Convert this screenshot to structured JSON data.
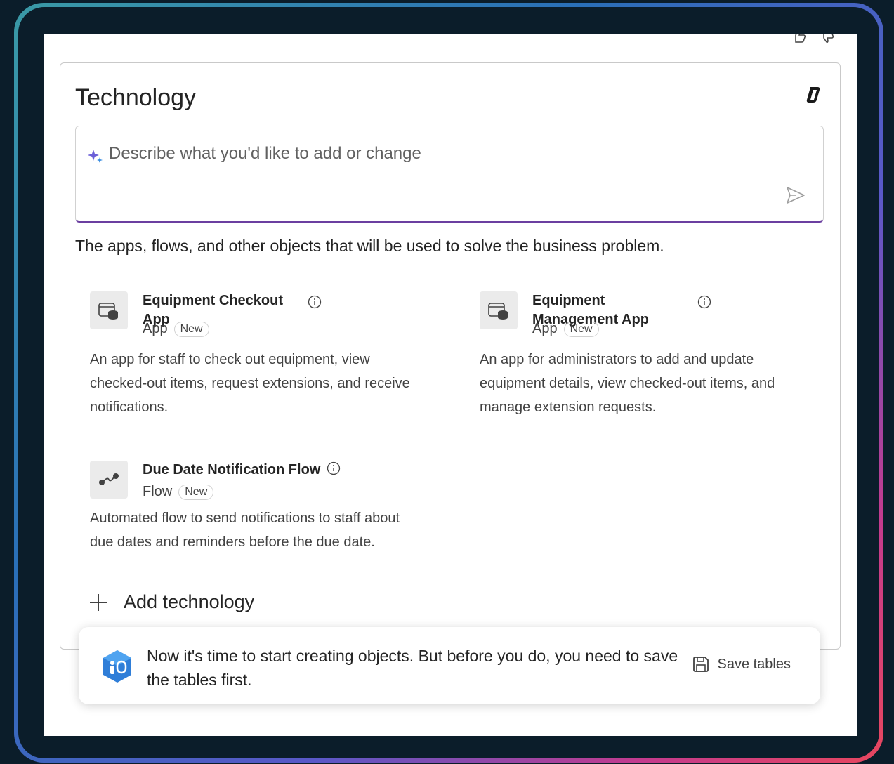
{
  "section": {
    "title": "Technology",
    "prompt_placeholder": "Describe what you'd like to add or change",
    "description": "The apps, flows, and other objects that will be used to solve the business problem."
  },
  "items": [
    {
      "title_line1": "Equipment Checkout",
      "title_line2": "App",
      "type": "App",
      "badge": "New",
      "desc_lines": [
        "An app for staff to check out equipment, view",
        "checked-out items, request extensions, and receive",
        "notifications."
      ],
      "icon": "app-icon"
    },
    {
      "title_line1": "Equipment",
      "title_line2": "Management App",
      "type": "App",
      "badge": "New",
      "desc_lines": [
        "An app for administrators to add and update",
        "equipment details, view checked-out items, and",
        "manage extension requests."
      ],
      "icon": "app-icon"
    },
    {
      "title_line1": "Due Date Notification Flow",
      "type": "Flow",
      "badge": "New",
      "desc_lines": [
        "Automated flow to send notifications to staff about",
        "due dates and reminders before the due date."
      ],
      "icon": "flow-icon"
    }
  ],
  "add_technology_label": "Add technology",
  "toast": {
    "message": "Now it's time to start creating objects. But before you do, you need to save the tables first.",
    "action_label": "Save tables"
  },
  "icons": [
    "thumbs-up-icon",
    "thumbs-down-icon",
    "copilot-icon",
    "sparkle-icon",
    "send-icon",
    "info-icon",
    "plus-icon",
    "save-icon"
  ]
}
